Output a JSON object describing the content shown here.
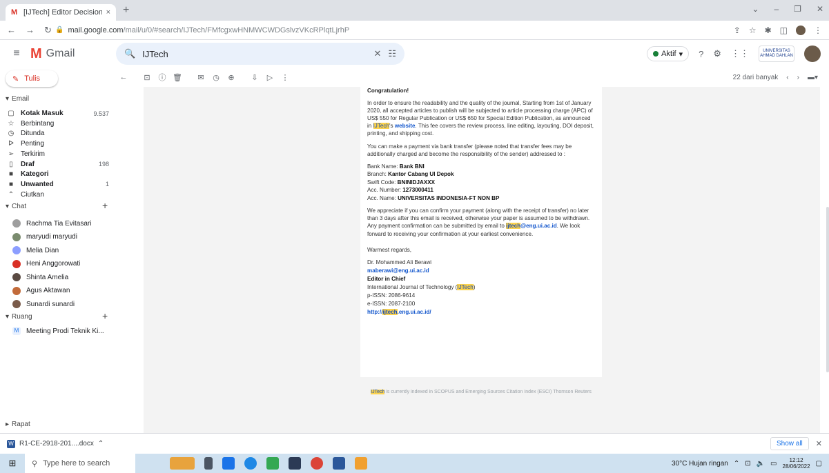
{
  "browser": {
    "tab_title": "[IJTech] Editor Decision - sitijami",
    "tab_close": "×",
    "new_tab": "+",
    "url_domain": "mail.google.com",
    "url_rest": "/mail/u/0/#search/IJTech/FMfcgxwHNMWCWDGslvzVKcRPlqtLjrhP"
  },
  "gmail": {
    "logo_text": "Gmail",
    "search_value": "IJTech",
    "status": "Aktif",
    "org_label": "UNIVERSITAS AHMAD DAHLAN"
  },
  "sidebar": {
    "compose_label": "Tulis",
    "email_section": "Email",
    "items": [
      {
        "label": "Kotak Masuk",
        "count": "9.537",
        "icon": "inbox-icon",
        "bold": true
      },
      {
        "label": "Berbintang",
        "count": "",
        "icon": "star-icon",
        "bold": false
      },
      {
        "label": "Ditunda",
        "count": "",
        "icon": "clock-icon",
        "bold": false
      },
      {
        "label": "Penting",
        "count": "",
        "icon": "important-icon",
        "bold": false
      },
      {
        "label": "Terkirim",
        "count": "",
        "icon": "send-icon",
        "bold": false
      },
      {
        "label": "Draf",
        "count": "198",
        "icon": "draft-icon",
        "bold": true
      },
      {
        "label": "Kategori",
        "count": "",
        "icon": "label-icon",
        "bold": true
      },
      {
        "label": "Unwanted",
        "count": "1",
        "icon": "label-icon",
        "bold": true
      },
      {
        "label": "Ciutkan",
        "count": "",
        "icon": "collapse-icon",
        "bold": false
      }
    ],
    "chat_section": "Chat",
    "chats": [
      {
        "name": "Rachma Tia Evitasari",
        "color": "#9e9e9e"
      },
      {
        "name": "maryudi maryudi",
        "color": "#7a8b6e"
      },
      {
        "name": "Melia Dian",
        "color": "#8c9eff"
      },
      {
        "name": "Heni Anggorowati",
        "color": "#d93025"
      },
      {
        "name": "Shinta Amelia",
        "color": "#5a4a42"
      },
      {
        "name": "Agus Aktawan",
        "color": "#c26b3a"
      },
      {
        "name": "Sunardi sunardi",
        "color": "#7a5b4a"
      }
    ],
    "rooms_section": "Ruang",
    "rooms": [
      {
        "name": "Meeting Prodi Teknik Ki...",
        "letter": "M"
      }
    ],
    "meet_section": "Rapat"
  },
  "toolbar": {
    "pager_text": "22 dari banyak"
  },
  "email": {
    "congratulation": "Congratulation!",
    "p1_a": "In order to ensure the readability and the quality of the journal, Starting from 1st of January 2020, all accepted articles to publish will be subjected to article processing charge (APC) of US$ 550 for Regular Publication or US$ 650 for Special Edition Publication, as announced in ",
    "p1_hl": "IJTech",
    "p1_b": "'s ",
    "p1_link": "website",
    "p1_c": ". This fee covers the review process, line editing, layouting, DOI deposit, printing, and shipping cost.",
    "p2": "You can make a payment via bank transfer (please noted that transfer fees may be additionally charged and become the responsibility of the sender) addressed to :",
    "bank_label": "Bank Name: ",
    "bank_value": "Bank BNI",
    "branch_label": "Branch: ",
    "branch_value": "Kantor Cabang UI Depok",
    "swift_label": "Swift Code: ",
    "swift_value": "BNINIDJAXXX",
    "acc_no_label": "Acc. Number: ",
    "acc_no_value": "1273000411",
    "acc_name_label": "Acc. Name: ",
    "acc_name_value": "UNIVERSITAS INDONESIA-FT NON BP",
    "p3_a": "We appreciate if you can confirm your payment (along with the receipt of transfer) no later than 3 days after this email is received, otherwise your paper is assumed to be withdrawn. Any payment confirmation can be submitted by email to ",
    "p3_email_hl": "ijtech",
    "p3_email_rest": "@eng.ui.ac.id",
    "p3_b": ". We look forward to receiving your confirmation at your earliest convenience.",
    "regards": "Warmest regards,",
    "sig_name": "Dr. Mohammed Ali Berawi",
    "sig_email": "maberawi@eng.ui.ac.id",
    "sig_title": "Editor in Chief",
    "sig_journal_a": "International Journal of Technology (",
    "sig_journal_hl": "IJTech",
    "sig_journal_b": ")",
    "sig_pissn": "p-ISSN: 2086-9614",
    "sig_eissn": "e-ISSN: 2087-2100",
    "sig_url_a": "http://",
    "sig_url_hl": "ijtech",
    "sig_url_b": ".eng.ui.ac.id/",
    "footer_hl": "IJTech",
    "footer_rest": " is currently indexed in SCOPUS and Emerging Sources Citation Index (ESCI) Thomson Reuters"
  },
  "download": {
    "file": "R1-CE-2918-201....docx",
    "show_all": "Show all"
  },
  "taskbar": {
    "search_placeholder": "Type here to search",
    "weather": "30°C  Hujan ringan",
    "time": "12:12",
    "date": "28/06/2022"
  }
}
